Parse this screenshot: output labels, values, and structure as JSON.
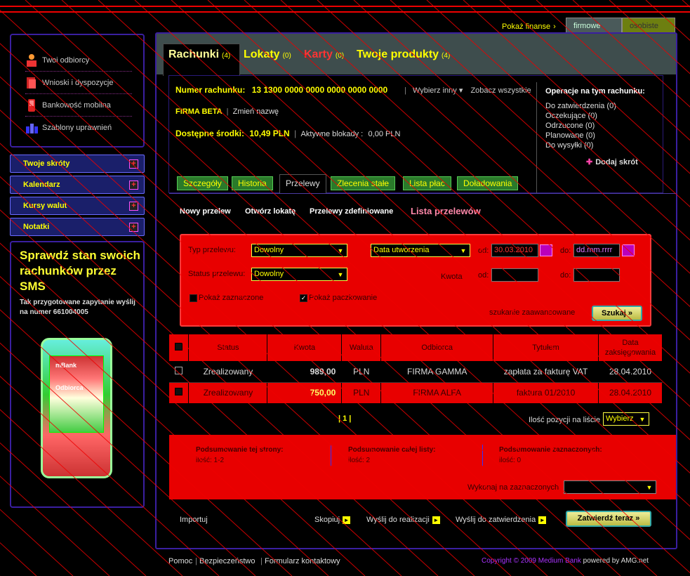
{
  "top": {
    "pokaz_finanse": "Pokaż finanse",
    "tab_firmowe": "firmowe",
    "tab_osobiste": "osobiste"
  },
  "sidebar": {
    "items": [
      {
        "label": "Twoi odbiorcy"
      },
      {
        "label": "Wnioski i dyspozycje"
      },
      {
        "label": "Bankowość mobilna"
      },
      {
        "label": "Szablony uprawnień"
      }
    ],
    "accordion": [
      {
        "label": "Twoje skróty"
      },
      {
        "label": "Kalendarz"
      },
      {
        "label": "Kursy walut"
      },
      {
        "label": "Notatki"
      }
    ],
    "promo": {
      "headline": "Sprawdź stan swoich rachunków przez SMS",
      "text": "Tak przygotowane zapytanie wyślij na numer 661004005",
      "phone_brand": "mBank",
      "phone_label": "Odbiorca"
    }
  },
  "tabs": [
    {
      "label": "Rachunki",
      "count": "(4)"
    },
    {
      "label": "Lokaty",
      "count": "(0)"
    },
    {
      "label": "Karty",
      "count": "(0)"
    },
    {
      "label": "Twoje produkty",
      "count": "(4)"
    }
  ],
  "account": {
    "number_label": "Numer rachunku:",
    "number": "13 1300 0000 0000 0000 0000 0000",
    "choose_other": "Wybierz inny",
    "see_all": "Zobacz wszystkie",
    "company": "FIRMA BETA",
    "rename": "Zmień nazwę",
    "available_label": "Dostępne środki:",
    "available": "10,49 PLN",
    "blocks_label": "Aktywne blokady :",
    "blocks": "0,00 PLN"
  },
  "operations": {
    "title": "Operacje na tym rachunku:",
    "items": [
      "Do zatwierdzenia (0)",
      "Oczekujące (0)",
      "Odrzucone (0)",
      "Planowane (0)",
      "Do wysyłki (0)"
    ],
    "add_shortcut": "Dodaj skrót"
  },
  "subtabs": [
    "Szczegóły",
    "Historia",
    "Przelewy",
    "Zlecenia stałe",
    "Lista płac",
    "Doładowania"
  ],
  "actions": [
    "Nowy przelew",
    "Otwórz lokatę",
    "Przelewy zdefiniowane",
    "Lista przelewów"
  ],
  "filter": {
    "type_label": "Typ przelewu:",
    "type_value": "Dowolny",
    "date_select": "Data utworzenia",
    "from_label": "od:",
    "from_date": "30.03.2010",
    "to_label": "do:",
    "to_date": "dd.mm.rrrr",
    "status_label": "Status przelewu:",
    "status_value": "Dowolny",
    "amount_label": "Kwota",
    "show_selected": "Pokaż zaznaczone",
    "show_batching": "Pokaż paczkowanie",
    "advanced": "szukanie zaawansowane",
    "search_btn": "Szukaj"
  },
  "table": {
    "headers": [
      "Status",
      "Kwota",
      "Waluta",
      "Odbiorca",
      "Tytułem",
      "Data zaksięgowania"
    ],
    "rows": [
      {
        "status": "Zrealizowany",
        "amount": "989,00",
        "currency": "PLN",
        "recipient": "FIRMA GAMMA",
        "title": "zapłata za fakturę VAT",
        "date": "28.04.2010"
      },
      {
        "status": "Zrealizowany",
        "amount": "750,00",
        "currency": "PLN",
        "recipient": "FIRMA ALFA",
        "title": "faktura 01/2010",
        "date": "28.04.2010"
      }
    ]
  },
  "pager": {
    "pages": "| 1 |",
    "per_page_label": "Ilość pozycji na liście",
    "per_page_value": "Wybierz"
  },
  "summary": [
    {
      "title": "Podsumowanie tej strony:",
      "value": "ilość: 1-2"
    },
    {
      "title": "Podsumowanie całej listy:",
      "value": "ilość: 2"
    },
    {
      "title": "Podsumowanie zaznaczonych:",
      "value": "ilość: 0"
    }
  ],
  "execute_label": "Wykonaj na zaznaczonych",
  "bottom": {
    "import": "Importuj",
    "copy": "Skopiuj",
    "send_realize": "Wyślij do realizacji",
    "send_approve": "Wyślij do zatwierdzenia",
    "approve_now": "Zatwierdź teraz"
  },
  "footer": {
    "links": [
      "Pomoc",
      "Bezpieczeństwo",
      "Formularz kontaktowy"
    ],
    "copyright": "Copyright © 2009 Medium Bank",
    "powered": "powered by AMG.net"
  }
}
